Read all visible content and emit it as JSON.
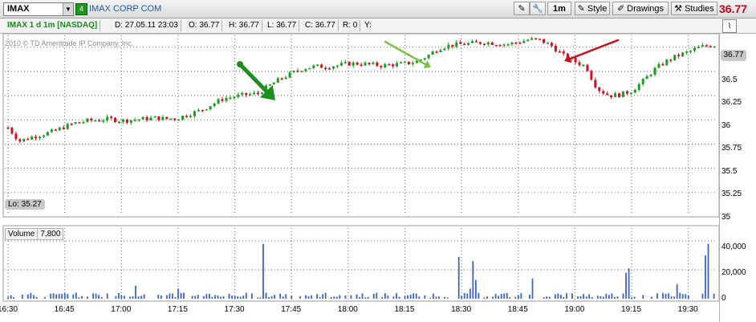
{
  "toolbar": {
    "symbol": "IMAX",
    "link_number": "4",
    "company": "IMAX CORP COM",
    "interval": "1m",
    "style_label": "Style",
    "drawings_label": "Drawings",
    "studies_label": "Studies",
    "last_price": "36.77"
  },
  "infobar": {
    "title": "IMAX 1 d 1m [NASDAQ]",
    "date": "D: 27.05.11 23:03",
    "open": "O: 36.77",
    "high": "H: 36.77",
    "low": "L: 36.77",
    "close": "C: 36.77",
    "range": "R: 0",
    "y": "Y:"
  },
  "copyright": "2010 © TD Ameritrade IP Company, Inc.",
  "lo_label": "Lo: 35.27",
  "current_price_label": "36.77",
  "volume_panel": {
    "label": "Volume",
    "value": "7,800"
  },
  "colors": {
    "up": "#1f9a1f",
    "down": "#d0101e",
    "volume": "#3a64c8",
    "arrow_green": "#1e8f1e",
    "arrow_light_green": "#7fc04a",
    "arrow_red": "#c0101e"
  },
  "icons": [
    "crosshair-icon",
    "wrench-icon",
    "style-icon",
    "drawings-icon",
    "studies-icon",
    "panel-icon"
  ],
  "chart_data": [
    {
      "type": "candlestick",
      "title": "IMAX 1 d 1m [NASDAQ]",
      "x_ticks": [
        "16:30",
        "16:45",
        "17:00",
        "17:15",
        "17:30",
        "17:45",
        "18:00",
        "18:15",
        "18:30",
        "18:45",
        "19:00",
        "19:15",
        "19:30"
      ],
      "y_ticks": [
        "36.75",
        "36.5",
        "36.25",
        "36",
        "35.75",
        "35.5",
        "35.25",
        "35"
      ],
      "ylim": [
        35,
        36.88
      ],
      "grid": true,
      "price_path": [
        [
          0,
          35.92
        ],
        [
          4,
          35.78
        ],
        [
          8,
          35.82
        ],
        [
          12,
          35.85
        ],
        [
          16,
          35.88
        ],
        [
          20,
          35.93
        ],
        [
          24,
          35.97
        ],
        [
          28,
          35.99
        ],
        [
          32,
          36.0
        ],
        [
          36,
          36.01
        ],
        [
          40,
          35.99
        ],
        [
          44,
          36.0
        ],
        [
          48,
          36.01
        ],
        [
          52,
          36.02
        ],
        [
          56,
          36.01
        ],
        [
          60,
          36.02
        ],
        [
          64,
          36.06
        ],
        [
          68,
          36.1
        ],
        [
          72,
          36.16
        ],
        [
          76,
          36.22
        ],
        [
          80,
          36.24
        ],
        [
          84,
          36.26
        ],
        [
          88,
          36.27
        ],
        [
          92,
          36.35
        ],
        [
          96,
          36.42
        ],
        [
          100,
          36.48
        ],
        [
          104,
          36.53
        ],
        [
          108,
          36.55
        ],
        [
          112,
          36.55
        ],
        [
          116,
          36.56
        ],
        [
          120,
          36.58
        ],
        [
          124,
          36.58
        ],
        [
          128,
          36.57
        ],
        [
          132,
          36.56
        ],
        [
          136,
          36.57
        ],
        [
          140,
          36.58
        ],
        [
          144,
          36.6
        ],
        [
          148,
          36.66
        ],
        [
          152,
          36.74
        ],
        [
          156,
          36.77
        ],
        [
          160,
          36.78
        ],
        [
          164,
          36.79
        ],
        [
          168,
          36.8
        ],
        [
          172,
          36.79
        ],
        [
          176,
          36.78
        ],
        [
          180,
          36.8
        ],
        [
          184,
          36.83
        ],
        [
          188,
          36.82
        ],
        [
          192,
          36.76
        ],
        [
          196,
          36.66
        ],
        [
          200,
          36.6
        ],
        [
          204,
          36.55
        ],
        [
          206,
          36.42
        ],
        [
          208,
          36.32
        ],
        [
          212,
          36.25
        ],
        [
          216,
          36.26
        ],
        [
          220,
          36.3
        ],
        [
          224,
          36.4
        ],
        [
          228,
          36.52
        ],
        [
          232,
          36.6
        ],
        [
          236,
          36.66
        ],
        [
          240,
          36.7
        ],
        [
          244,
          36.75
        ],
        [
          248,
          36.77
        ],
        [
          250,
          36.77
        ]
      ],
      "minutes_total": 250
    },
    {
      "type": "bar",
      "title": "Volume",
      "y_ticks": [
        "40,000",
        "20,000",
        "0"
      ],
      "ylim": [
        0,
        40000
      ],
      "spikes": [
        {
          "minute": 90,
          "value": 38000
        },
        {
          "minute": 159,
          "value": 29000
        },
        {
          "minute": 164,
          "value": 26000
        },
        {
          "minute": 165,
          "value": 13000
        },
        {
          "minute": 185,
          "value": 14000
        },
        {
          "minute": 218,
          "value": 18000
        },
        {
          "minute": 219,
          "value": 21000
        },
        {
          "minute": 163,
          "value": 7000
        },
        {
          "minute": 246,
          "value": 30000
        },
        {
          "minute": 247,
          "value": 38000
        },
        {
          "minute": 45,
          "value": 9000
        },
        {
          "minute": 60,
          "value": 7000
        },
        {
          "minute": 236,
          "value": 10000
        }
      ],
      "base_volume": 2500
    }
  ]
}
